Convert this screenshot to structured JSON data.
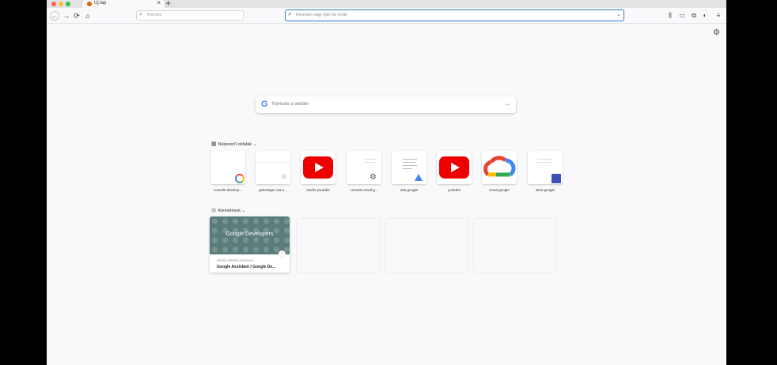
{
  "browser": {
    "tab_title": "Új lap",
    "tab_close": "×",
    "new_tab": "+",
    "search_placeholder": "Keresés",
    "url_placeholder": "Keressen vagy írjon be címet",
    "colors": {
      "accent": "#2b7bd3",
      "close": "#fd5f57",
      "minimize": "#febc2e",
      "zoom": "#28c840"
    }
  },
  "nav": {
    "back": "←",
    "forward": "→",
    "reload": "⟳",
    "home": "⌂"
  },
  "page": {
    "google_search_placeholder": "Keresés a weben",
    "top_sites_heading": "Népszerű oldalak",
    "highlights_heading": "Kiemelések",
    "top_sites": [
      {
        "label": "console.develop..."
      },
      {
        "label": "gstoraage.cas.n..."
      },
      {
        "label": "studio.youtube"
      },
      {
        "label": "console.cloud.g..."
      },
      {
        "label": "ads.google"
      },
      {
        "label": "youtube"
      },
      {
        "label": "cloud.google"
      },
      {
        "label": "sites.google"
      }
    ],
    "highlight_card": {
      "image_text": "Google Developers",
      "source": "DEVELOPERS.GOOGLE",
      "title": "Google Assistant | Google De..."
    }
  }
}
